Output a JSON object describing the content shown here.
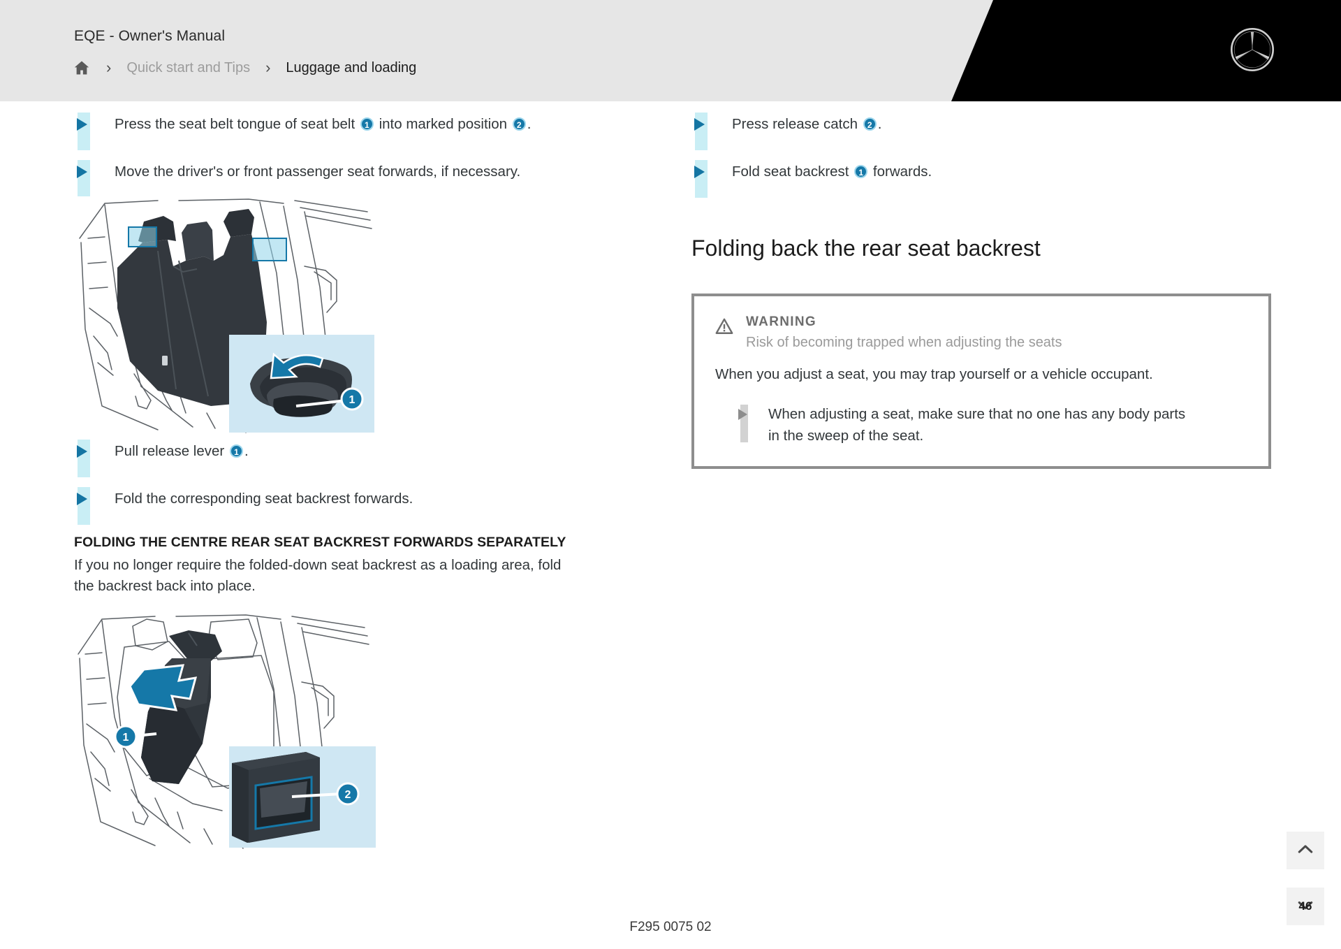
{
  "header": {
    "manual_title": "EQE - Owner's Manual",
    "home_icon": "home-icon",
    "separator": "›",
    "breadcrumb": [
      {
        "label": "Quick start and Tips",
        "current": false
      },
      {
        "label": "Luggage and loading",
        "current": true
      }
    ],
    "brand_logo": "mercedes-star-logo",
    "background": "#e6e6e6",
    "accent_black": "#000000"
  },
  "left_column": {
    "bullets_top": [
      {
        "parts": [
          {
            "t": "text",
            "v": "Press the seat belt tongue of seat belt "
          },
          {
            "t": "num",
            "v": "1"
          },
          {
            "t": "text",
            "v": " into marked position "
          },
          {
            "t": "num",
            "v": "2"
          },
          {
            "t": "text",
            "v": "."
          }
        ]
      },
      {
        "parts": [
          {
            "t": "text",
            "v": "Move the driver's or front passenger seat forwards, if necessary."
          }
        ]
      }
    ],
    "figure_1": {
      "name": "rear-seat-backrest-illustration",
      "callouts": [
        "1"
      ],
      "description": "Rear bench seat with head restraints and inset detail of release lever"
    },
    "bullets_mid": [
      {
        "parts": [
          {
            "t": "text",
            "v": "Pull release lever "
          },
          {
            "t": "num",
            "v": "1"
          },
          {
            "t": "text",
            "v": "."
          }
        ]
      },
      {
        "parts": [
          {
            "t": "text",
            "v": "Fold the corresponding seat backrest forwards."
          }
        ]
      }
    ],
    "section_heading": "FOLDING THE CENTRE REAR SEAT BACKREST FORWARDS SEPARATELY",
    "section_paragraph": "If you no longer require the folded-down seat backrest as a loading area, fold the backrest back into place.",
    "figure_2": {
      "name": "centre-rear-backrest-illustration",
      "callouts": [
        "1",
        "2"
      ],
      "description": "Centre rear seat backrest being folded forwards with inset detail of release catch"
    }
  },
  "right_column": {
    "bullets_top": [
      {
        "parts": [
          {
            "t": "text",
            "v": "Press release catch "
          },
          {
            "t": "num",
            "v": "2"
          },
          {
            "t": "text",
            "v": "."
          }
        ]
      },
      {
        "parts": [
          {
            "t": "text",
            "v": "Fold seat backrest "
          },
          {
            "t": "num",
            "v": "1"
          },
          {
            "t": "text",
            "v": " forwards."
          }
        ]
      }
    ],
    "heading": "Folding back the rear seat backrest",
    "warning": {
      "icon": "warning-triangle-icon",
      "title": "WARNING",
      "subtitle": "Risk of becoming trapped when adjusting the seats",
      "body": "When you adjust a seat, you may trap yourself or a vehicle occupant.",
      "bullets": [
        "When adjusting a seat, make sure that no one has any body parts in the sweep of the seat."
      ],
      "border_color": "#8e8e8e"
    }
  },
  "footer": {
    "figure_code": "F295 0075 02"
  },
  "controls": {
    "scroll_top": {
      "icon": "chevron-up-icon",
      "label": ""
    },
    "next_page": {
      "icon": "chevron-down-icon",
      "page_number": "46"
    }
  },
  "colors": {
    "bullet_blue": "#1475a3",
    "bullet_bar": "#c9eef5",
    "callout_blue": "#1578a8",
    "callout_ring": "#9dd6ec",
    "text": "#32373a",
    "muted": "#9a9a9a"
  }
}
